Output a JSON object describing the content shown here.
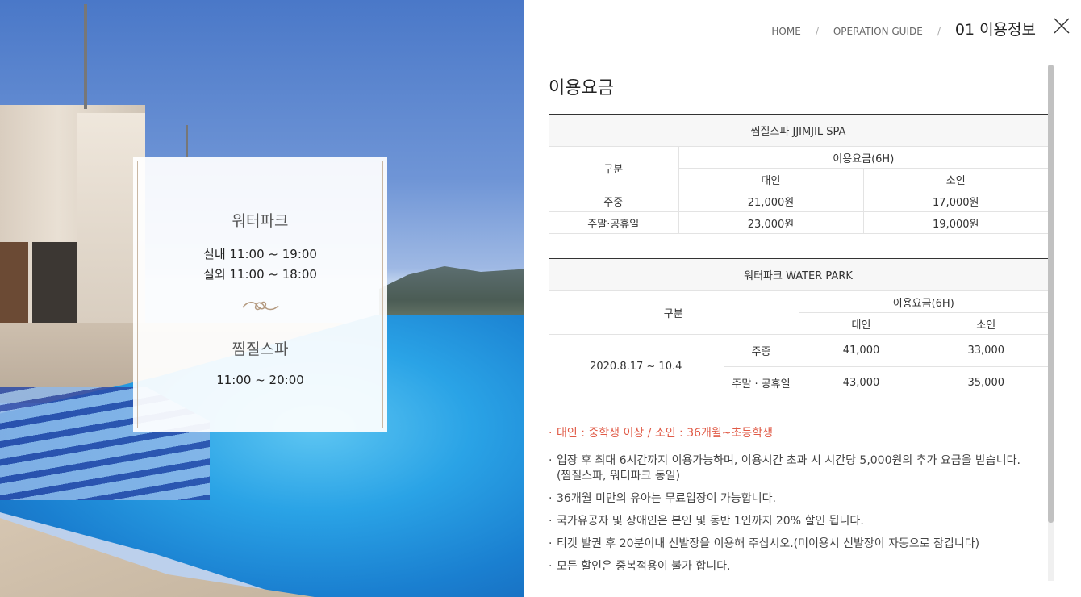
{
  "breadcrumb": {
    "home": "HOME",
    "guide": "OPERATION GUIDE",
    "current": "01 이용정보"
  },
  "card": {
    "waterpark_title": "워터파크",
    "waterpark_indoor": "실내 11:00 ~ 19:00",
    "waterpark_outdoor": "실외 11:00 ~ 18:00",
    "spa_title": "찜질스파",
    "spa_hours": "11:00 ~ 20:00"
  },
  "section_title": "이용요금",
  "spa_table": {
    "caption": "찜질스파 JJIMJIL SPA",
    "col_category": "구분",
    "col_fee": "이용요금(6H)",
    "col_adult": "대인",
    "col_child": "소인",
    "rows": [
      {
        "label": "주중",
        "adult": "21,000원",
        "child": "17,000원"
      },
      {
        "label": "주말·공휴일",
        "adult": "23,000원",
        "child": "19,000원"
      }
    ]
  },
  "water_table": {
    "caption": "워터파크 WATER PARK",
    "col_category": "구분",
    "col_fee": "이용요금(6H)",
    "col_adult": "대인",
    "col_child": "소인",
    "period": "2020.8.17 ~ 10.4",
    "rows": [
      {
        "label": "주중",
        "adult": "41,000",
        "child": "33,000"
      },
      {
        "label": "주말 · 공휴일",
        "adult": "43,000",
        "child": "35,000"
      }
    ]
  },
  "notes": {
    "age": "대인 : 중학생 이상 / 소인 : 36개월~초등학생",
    "items": [
      "입장 후 최대 6시간까지 이용가능하며, 이용시간 초과 시 시간당 5,000원의 추가 요금을 받습니다.",
      "36개월 미만의 유아는 무료입장이 가능합니다.",
      "국가유공자 및 장애인은 본인 및 동반 1인까지 20% 할인 됩니다.",
      "티켓 발권 후 20분이내 신발장을 이용해 주십시오.(미이용시 신발장이 자동으로 잠깁니다)",
      "모든 할인은 중복적용이 불가 합니다."
    ],
    "sub": "(찜질스파, 워터파크 동일)"
  },
  "colors": {
    "accent_red": "#e05a46",
    "card_border": "#c9b7a3"
  },
  "icons": {
    "close": "close-icon",
    "ornament": "flourish-ornament-icon"
  }
}
